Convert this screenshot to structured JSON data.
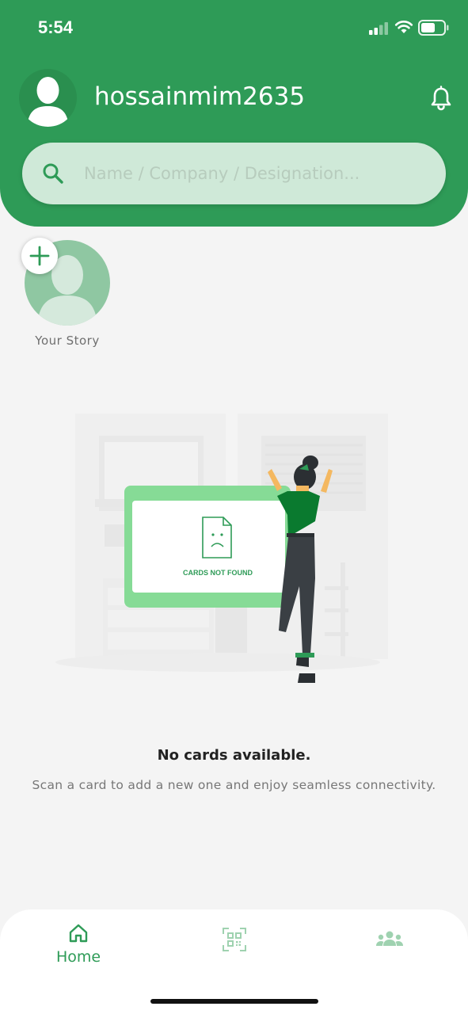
{
  "status_bar": {
    "time": "5:54"
  },
  "header": {
    "username": "hossainmim2635",
    "avatar_icon": "user-silhouette-icon",
    "notification_icon": "bell-icon"
  },
  "search": {
    "placeholder": "Name / Company / Designation...",
    "value": ""
  },
  "story": {
    "label": "Your Story",
    "add_icon": "plus-icon"
  },
  "illustration": {
    "card_text": "CARDS NOT FOUND"
  },
  "empty_state": {
    "title": "No cards available.",
    "subtitle": "Scan a card to add a new one and enjoy seamless connectivity."
  },
  "tabbar": {
    "home_label": "Home",
    "scan_icon": "qr-scan-icon",
    "contacts_icon": "people-icon"
  },
  "colors": {
    "primary": "#2e9b57",
    "search_bg": "#cfe9d8",
    "background": "#f4f4f4"
  }
}
